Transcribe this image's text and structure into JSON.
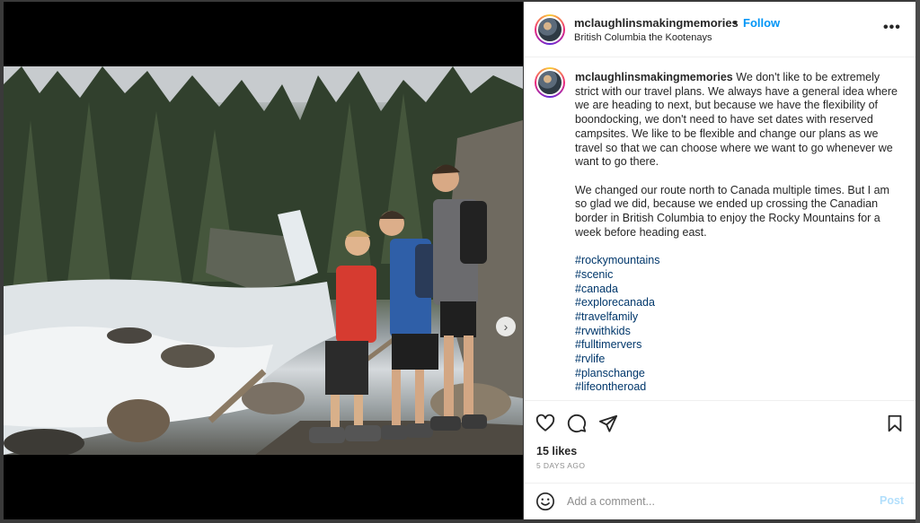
{
  "post": {
    "username": "mclaughlinsmakingmemories",
    "separator": "•",
    "follow_label": "Follow",
    "location": "British Columbia the Kootenays",
    "more_label": "•••",
    "caption": {
      "username": "mclaughlinsmakingmemories",
      "paragraph1": "We don't like to be extremely strict with our travel plans. We always have a general idea where we are heading to next, but because we have the flexibility of boondocking, we don't need to have set dates with reserved campsites. We like to be flexible and change our plans as we travel so that we can choose where we want to go whenever we want to go there.",
      "paragraph2": "We changed our route north to Canada multiple times. But I am so glad we did, because we ended up crossing the Canadian border in British Columbia to enjoy the Rocky Mountains for a week before heading east.",
      "hashtags": [
        "#rockymountains",
        "#scenic",
        "#canada",
        "#explorecanada",
        "#travelfamily",
        "#rvwithkids",
        "#fulltimervers",
        "#rvlife",
        "#planschange",
        "#lifeontheroad"
      ]
    },
    "likes": "15 likes",
    "time_ago": "5 DAYS AGO",
    "comment_placeholder": "Add a comment...",
    "post_label": "Post"
  },
  "media": {
    "next_label": "›"
  },
  "icons": {
    "like": "heart-icon",
    "comment": "comment-icon",
    "share": "share-icon",
    "save": "bookmark-icon",
    "emoji": "emoji-icon",
    "more": "more-icon",
    "next": "chevron-right-icon"
  },
  "colors": {
    "follow": "#0095f6",
    "hashtag": "#00376b",
    "post_disabled": "#b2dffc",
    "muted": "#8e8e8e"
  }
}
